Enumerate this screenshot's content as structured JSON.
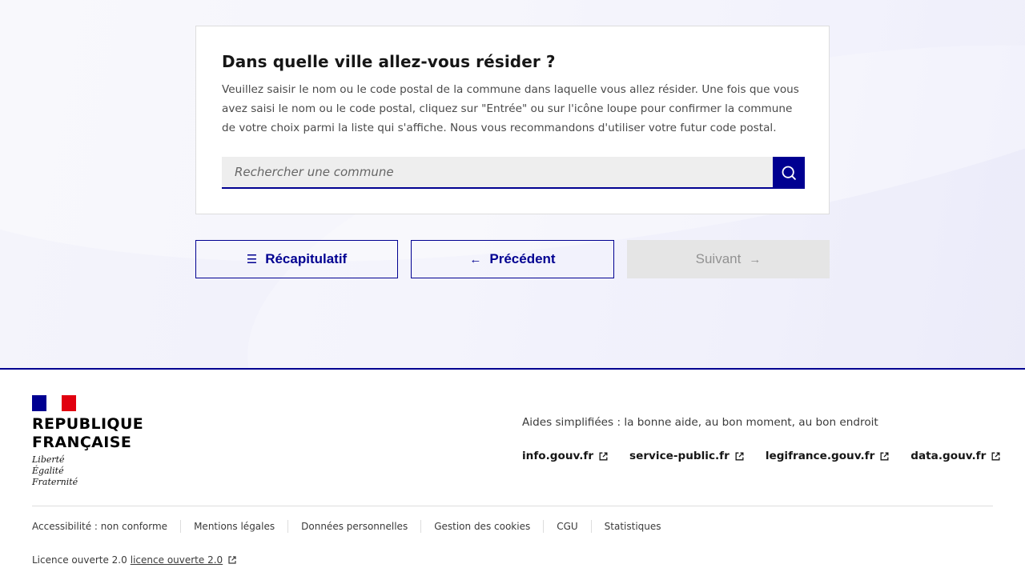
{
  "question": {
    "title": "Dans quelle ville allez-vous résider ?",
    "description": "Veuillez saisir le nom ou le code postal de la commune dans laquelle vous allez résider. Une fois que vous avez saisi le nom ou le code postal, cliquez sur \"Entrée\" ou sur l'icône loupe pour confirmer la commune de votre choix parmi la liste qui s'affiche. Nous vous recommandons d'utiliser votre futur code postal.",
    "search_placeholder": "Rechercher une commune",
    "search_value": ""
  },
  "navigation": {
    "recap_label": "Récapitulatif",
    "prev_label": "Précédent",
    "next_label": "Suivant",
    "recap_icon": "☰",
    "prev_icon": "←",
    "next_icon": "→"
  },
  "footer": {
    "brand": "REPUBLIQUE FRANÇAISE",
    "motto": [
      "Liberté",
      "Égalité",
      "Fraternité"
    ],
    "tagline": "Aides simplifiées : la bonne aide, au bon moment, au bon endroit",
    "external_links": [
      "info.gouv.fr",
      "service-public.fr",
      "legifrance.gouv.fr",
      "data.gouv.fr"
    ],
    "bottom_links": [
      "Accessibilité : non conforme",
      "Mentions légales",
      "Données personnelles",
      "Gestion des cookies",
      "CGU",
      "Statistiques"
    ],
    "license_text": "Licence ouverte 2.0",
    "license_link": "licence ouverte 2.0"
  },
  "colors": {
    "primary": "#000091",
    "disabled_bg": "#e5e5e5",
    "disabled_text": "#929292",
    "flag_red": "#e1000f"
  }
}
